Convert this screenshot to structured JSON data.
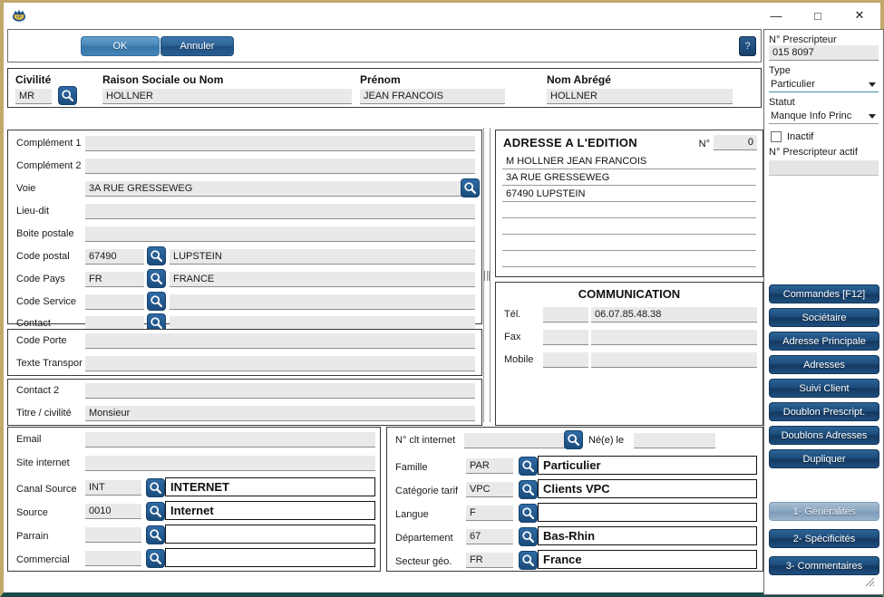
{
  "window": {
    "app_icon": "app-logo-icon",
    "minimize": "—",
    "maximize": "□",
    "close": "✕"
  },
  "toolbar": {
    "ok_label": "OK",
    "cancel_label": "Annuler",
    "help_label": "?"
  },
  "identity": {
    "civilite_label": "Civilité",
    "civilite_value": "MR",
    "raison_label": "Raison Sociale ou Nom",
    "raison_value": "HOLLNER",
    "prenom_label": "Prénom",
    "prenom_value": "JEAN FRANCOIS",
    "nom_abrege_label": "Nom Abrégé",
    "nom_abrege_value": "HOLLNER"
  },
  "address": {
    "rows": [
      {
        "label": "Complément 1",
        "value": ""
      },
      {
        "label": "Complément 2",
        "value": ""
      },
      {
        "label": "Voie",
        "value": "3A RUE GRESSEWEG"
      },
      {
        "label": "Lieu-dit",
        "value": ""
      },
      {
        "label": "Boite postale",
        "value": ""
      }
    ],
    "code_postal_label": "Code postal",
    "code_postal_value": "67490",
    "ville_value": "LUPSTEIN",
    "code_pays_label": "Code Pays",
    "code_pays_value": "FR",
    "pays_value": "FRANCE",
    "code_service_label": "Code Service",
    "code_service_value": "",
    "service_value": "",
    "contact_label": "Contact",
    "contact_value": "",
    "contact_name_value": ""
  },
  "transport": {
    "code_porte_label": "Code Porte",
    "code_porte_value": "",
    "texte_transport_label": "Texte Transpor",
    "texte_transport_value": ""
  },
  "contact2": {
    "contact2_label": "Contact 2",
    "contact2_value": "",
    "titre_label": "Titre / civilité",
    "titre_value": "Monsieur"
  },
  "edition": {
    "title": "ADRESSE A L'EDITION",
    "num_label": "N°",
    "num_value": "0",
    "lines": [
      "M HOLLNER JEAN FRANCOIS",
      "3A RUE GRESSEWEG",
      "67490 LUPSTEIN",
      "",
      "",
      "",
      ""
    ]
  },
  "communication": {
    "title": "COMMUNICATION",
    "rows": [
      {
        "label": "Tél.",
        "code": "",
        "value": "06.07.85.48.38"
      },
      {
        "label": "Fax",
        "code": "",
        "value": ""
      },
      {
        "label": "Mobile",
        "code": "",
        "value": ""
      }
    ]
  },
  "internet": {
    "email_label": "Email",
    "email_value": "",
    "site_label": "Site internet",
    "site_value": "",
    "rows": [
      {
        "label": "Canal Source",
        "code": "INT",
        "value": "INTERNET"
      },
      {
        "label": "Source",
        "code": "0010",
        "value": "Internet"
      },
      {
        "label": "Parrain",
        "code": "",
        "value": ""
      },
      {
        "label": "Commercial",
        "code": "",
        "value": ""
      }
    ]
  },
  "classification": {
    "nclt_label": "N° clt internet",
    "nclt_value": "",
    "nele_label": "Né(e) le",
    "nele_value": "",
    "rows": [
      {
        "label": "Famille",
        "code": "PAR",
        "value": "Particulier"
      },
      {
        "label": "Catégorie tarif",
        "code": "VPC",
        "value": "Clients VPC"
      },
      {
        "label": "Langue",
        "code": "F",
        "value": ""
      },
      {
        "label": "Département",
        "code": "67",
        "value": "Bas-Rhin"
      },
      {
        "label": "Secteur géo.",
        "code": "FR",
        "value": "France"
      }
    ]
  },
  "rightpanel": {
    "prescripteur_label": "N° Prescripteur",
    "prescripteur_value": "015 8097",
    "type_label": "Type",
    "type_value": "Particulier",
    "statut_label": "Statut",
    "statut_value": "Manque Info Princ",
    "inactif_label": "Inactif",
    "prescripteur_actif_label": "N° Prescripteur actif",
    "prescripteur_actif_value": "",
    "buttons": [
      "Commandes [F12]",
      "Sociétaire",
      "Adresse Principale",
      "Adresses",
      "Suivi Client",
      "Doublon Prescript.",
      "Doublons Adresses",
      "Dupliquer"
    ],
    "tabs": [
      {
        "label": "1- Généralités",
        "active": true
      },
      {
        "label": "2- Spécificités",
        "active": false
      },
      {
        "label": "3- Commentaires",
        "active": false
      }
    ]
  },
  "colors": {
    "accent": "#1b4a79",
    "window_border": "#c2a96b",
    "status_bar": "#1b4a4a",
    "field_bg": "#e9e9e9"
  }
}
